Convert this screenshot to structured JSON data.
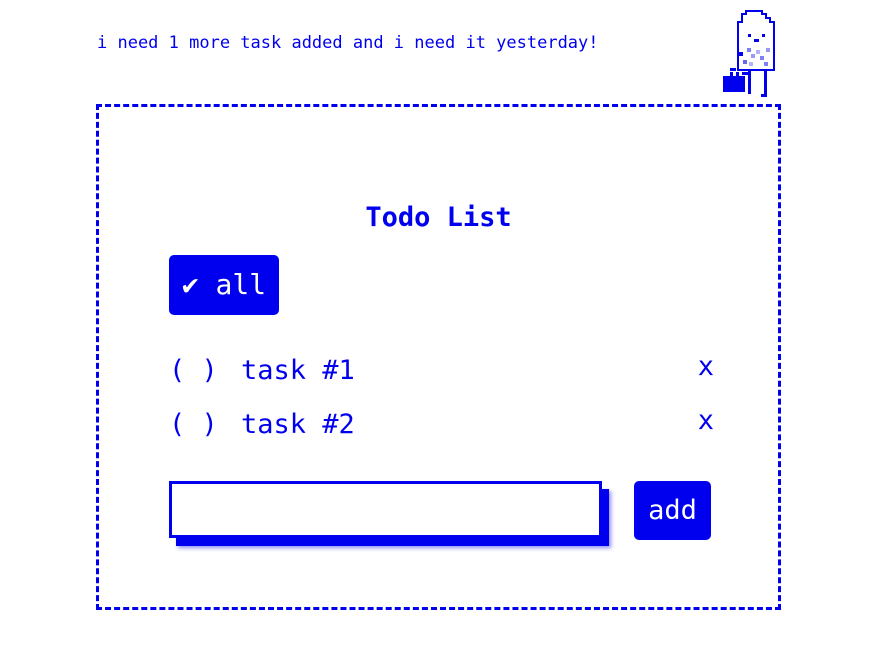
{
  "speech": {
    "text": "i need 1 more task added and i need it yesterday!"
  },
  "mascot": {
    "icon": "ghost-with-briefcase-icon"
  },
  "todo": {
    "title": "Todo List",
    "toggle_all_label": "✔ all",
    "tasks": [
      {
        "checkbox": "( )",
        "label": "task #1",
        "delete_label": "x"
      },
      {
        "checkbox": "( )",
        "label": "task #2",
        "delete_label": "x"
      }
    ],
    "new_task_value": "",
    "add_label": "add"
  },
  "colors": {
    "accent": "#0000ee",
    "background": "#ffffff"
  }
}
